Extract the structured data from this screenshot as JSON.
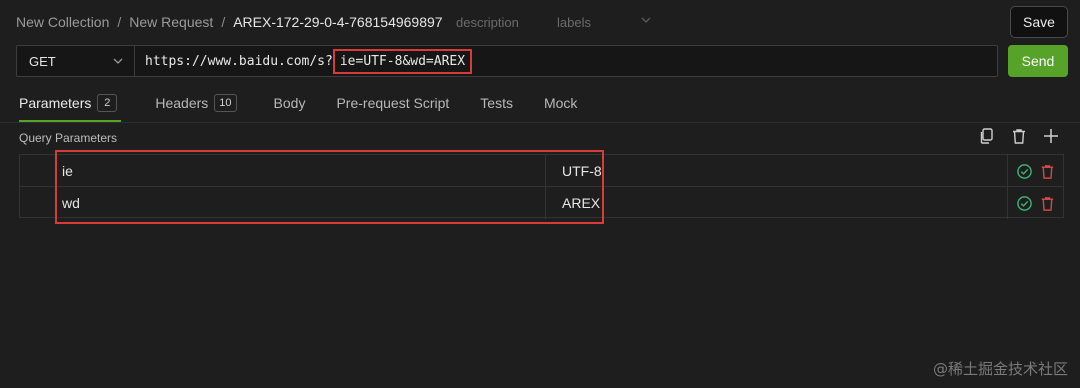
{
  "breadcrumb": {
    "collection": "New Collection",
    "request": "New Request",
    "id": "AREX-172-29-0-4-768154969897",
    "separator": "/"
  },
  "meta": {
    "description": "description",
    "labels": "labels"
  },
  "save_label": "Save",
  "method": {
    "value": "GET"
  },
  "url": {
    "base": "https://www.baidu.com/s?",
    "query": "ie=UTF-8&wd=AREX"
  },
  "send_label": "Send",
  "tabs": [
    {
      "label": "Parameters",
      "badge": "2"
    },
    {
      "label": "Headers",
      "badge": "10"
    },
    {
      "label": "Body"
    },
    {
      "label": "Pre-request Script"
    },
    {
      "label": "Tests"
    },
    {
      "label": "Mock"
    }
  ],
  "query_params": {
    "title": "Query Parameters",
    "rows": [
      {
        "key": "ie",
        "value": "UTF-8"
      },
      {
        "key": "wd",
        "value": "AREX"
      }
    ]
  },
  "watermark": "@稀土掘金技术社区",
  "colors": {
    "accent": "#57a329",
    "highlight": "#d93b3b",
    "ok": "#3bb273",
    "danger": "#d04848"
  },
  "icons": [
    "chevron-down-icon",
    "copy-icon",
    "trash-icon",
    "plus-icon",
    "check-circle-icon",
    "delete-icon"
  ]
}
